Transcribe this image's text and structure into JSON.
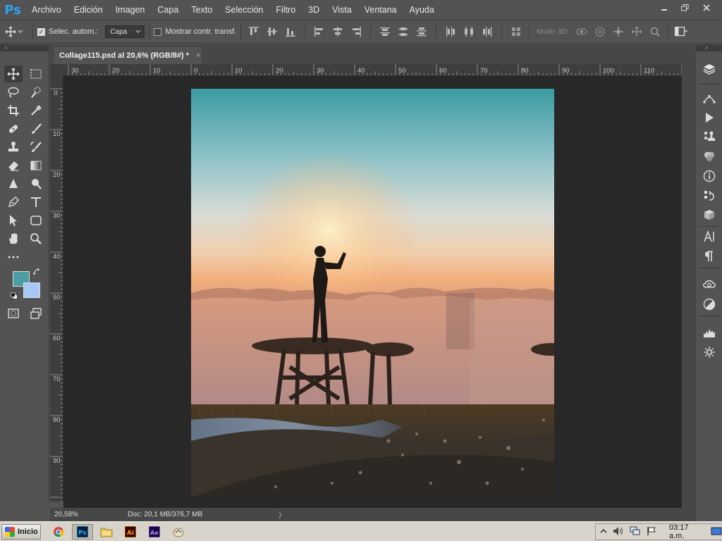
{
  "app": {
    "logo": "Ps",
    "menu": [
      "Archivo",
      "Edición",
      "Imagen",
      "Capa",
      "Texto",
      "Selección",
      "Filtro",
      "3D",
      "Vista",
      "Ventana",
      "Ayuda"
    ],
    "window_controls": [
      "minimize-icon",
      "restore-icon",
      "close-icon"
    ]
  },
  "options_bar": {
    "auto_select_label": "Selec. autom.:",
    "auto_select_checked": true,
    "auto_select_target": "Capa",
    "show_transform_label": "Mostrar contr. transf.",
    "show_transform_checked": false,
    "mode3d_label": "Modo 3D:"
  },
  "document": {
    "tab_title": "Collage115.psd al 20,6% (RGB/8#) *",
    "close_glyph": "×"
  },
  "rulers": {
    "top": [
      "30",
      "20",
      "10",
      "0",
      "10",
      "20",
      "30",
      "40",
      "50",
      "60",
      "70",
      "80",
      "90",
      "100",
      "110"
    ],
    "left": [
      "0",
      "10",
      "20",
      "30",
      "40",
      "50",
      "60",
      "70",
      "80",
      "90"
    ]
  },
  "status": {
    "zoom": "20,58%",
    "doc_info": "Doc: 20,1 MB/376,7 MB",
    "arrow": "〉"
  },
  "colors": {
    "foreground": "#4a9ea3",
    "background": "#a5c8f5",
    "ui_panel": "#535353",
    "pasteboard": "#282828"
  },
  "left_tools": [
    "move-tool-icon",
    "rect-marquee-icon",
    "lasso-icon",
    "quick-select-icon",
    "crop-icon",
    "eyedropper-icon",
    "healing-brush-icon",
    "brush-icon",
    "clone-stamp-icon",
    "history-brush-icon",
    "eraser-icon",
    "gradient-icon",
    "blur-icon",
    "dodge-icon",
    "pen-icon",
    "type-icon",
    "path-select-icon",
    "shape-icon",
    "hand-icon",
    "zoom-icon",
    "more-tools-icon"
  ],
  "right_panels": [
    "layers-icon",
    "paths-icon",
    "actions-icon",
    "clone-source-icon",
    "adjustments-icon",
    "info-icon",
    "history-icon",
    "3d-icon",
    "character-icon",
    "paragraph-icon",
    "libraries-icon",
    "styles-icon",
    "histogram-icon",
    "navigator-icon"
  ],
  "taskbar": {
    "start_label": "Inicio",
    "apps": [
      {
        "name": "Chrome",
        "glyph": "●"
      },
      {
        "name": "Ps",
        "glyph": "Ps"
      },
      {
        "name": "Explorer",
        "glyph": "▤"
      },
      {
        "name": "Ai",
        "glyph": "Ai"
      },
      {
        "name": "Ae",
        "glyph": "Ae"
      },
      {
        "name": "Paint",
        "glyph": "✎"
      }
    ],
    "clock": "03:17 a.m."
  }
}
